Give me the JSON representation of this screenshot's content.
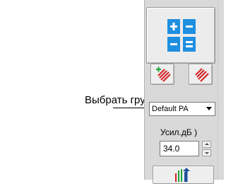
{
  "callout": {
    "label": "Выбрать группу"
  },
  "toolbar": {
    "main_button_icon": "calculator-icon",
    "add_button_icon": "add-group-icon",
    "remove_button_icon": "remove-group-icon",
    "bottom_button_icon": "chart-cursor-icon"
  },
  "group_select": {
    "value": "Default PA",
    "options": [
      "Default PA"
    ]
  },
  "gain": {
    "label": "Усил.дБ )",
    "value": "34.0"
  },
  "colors": {
    "accent_blue": "#1f8fe0",
    "icon_red": "#d6262a",
    "icon_green": "#1aa33b",
    "panel_bg": "#d9d9d9"
  }
}
